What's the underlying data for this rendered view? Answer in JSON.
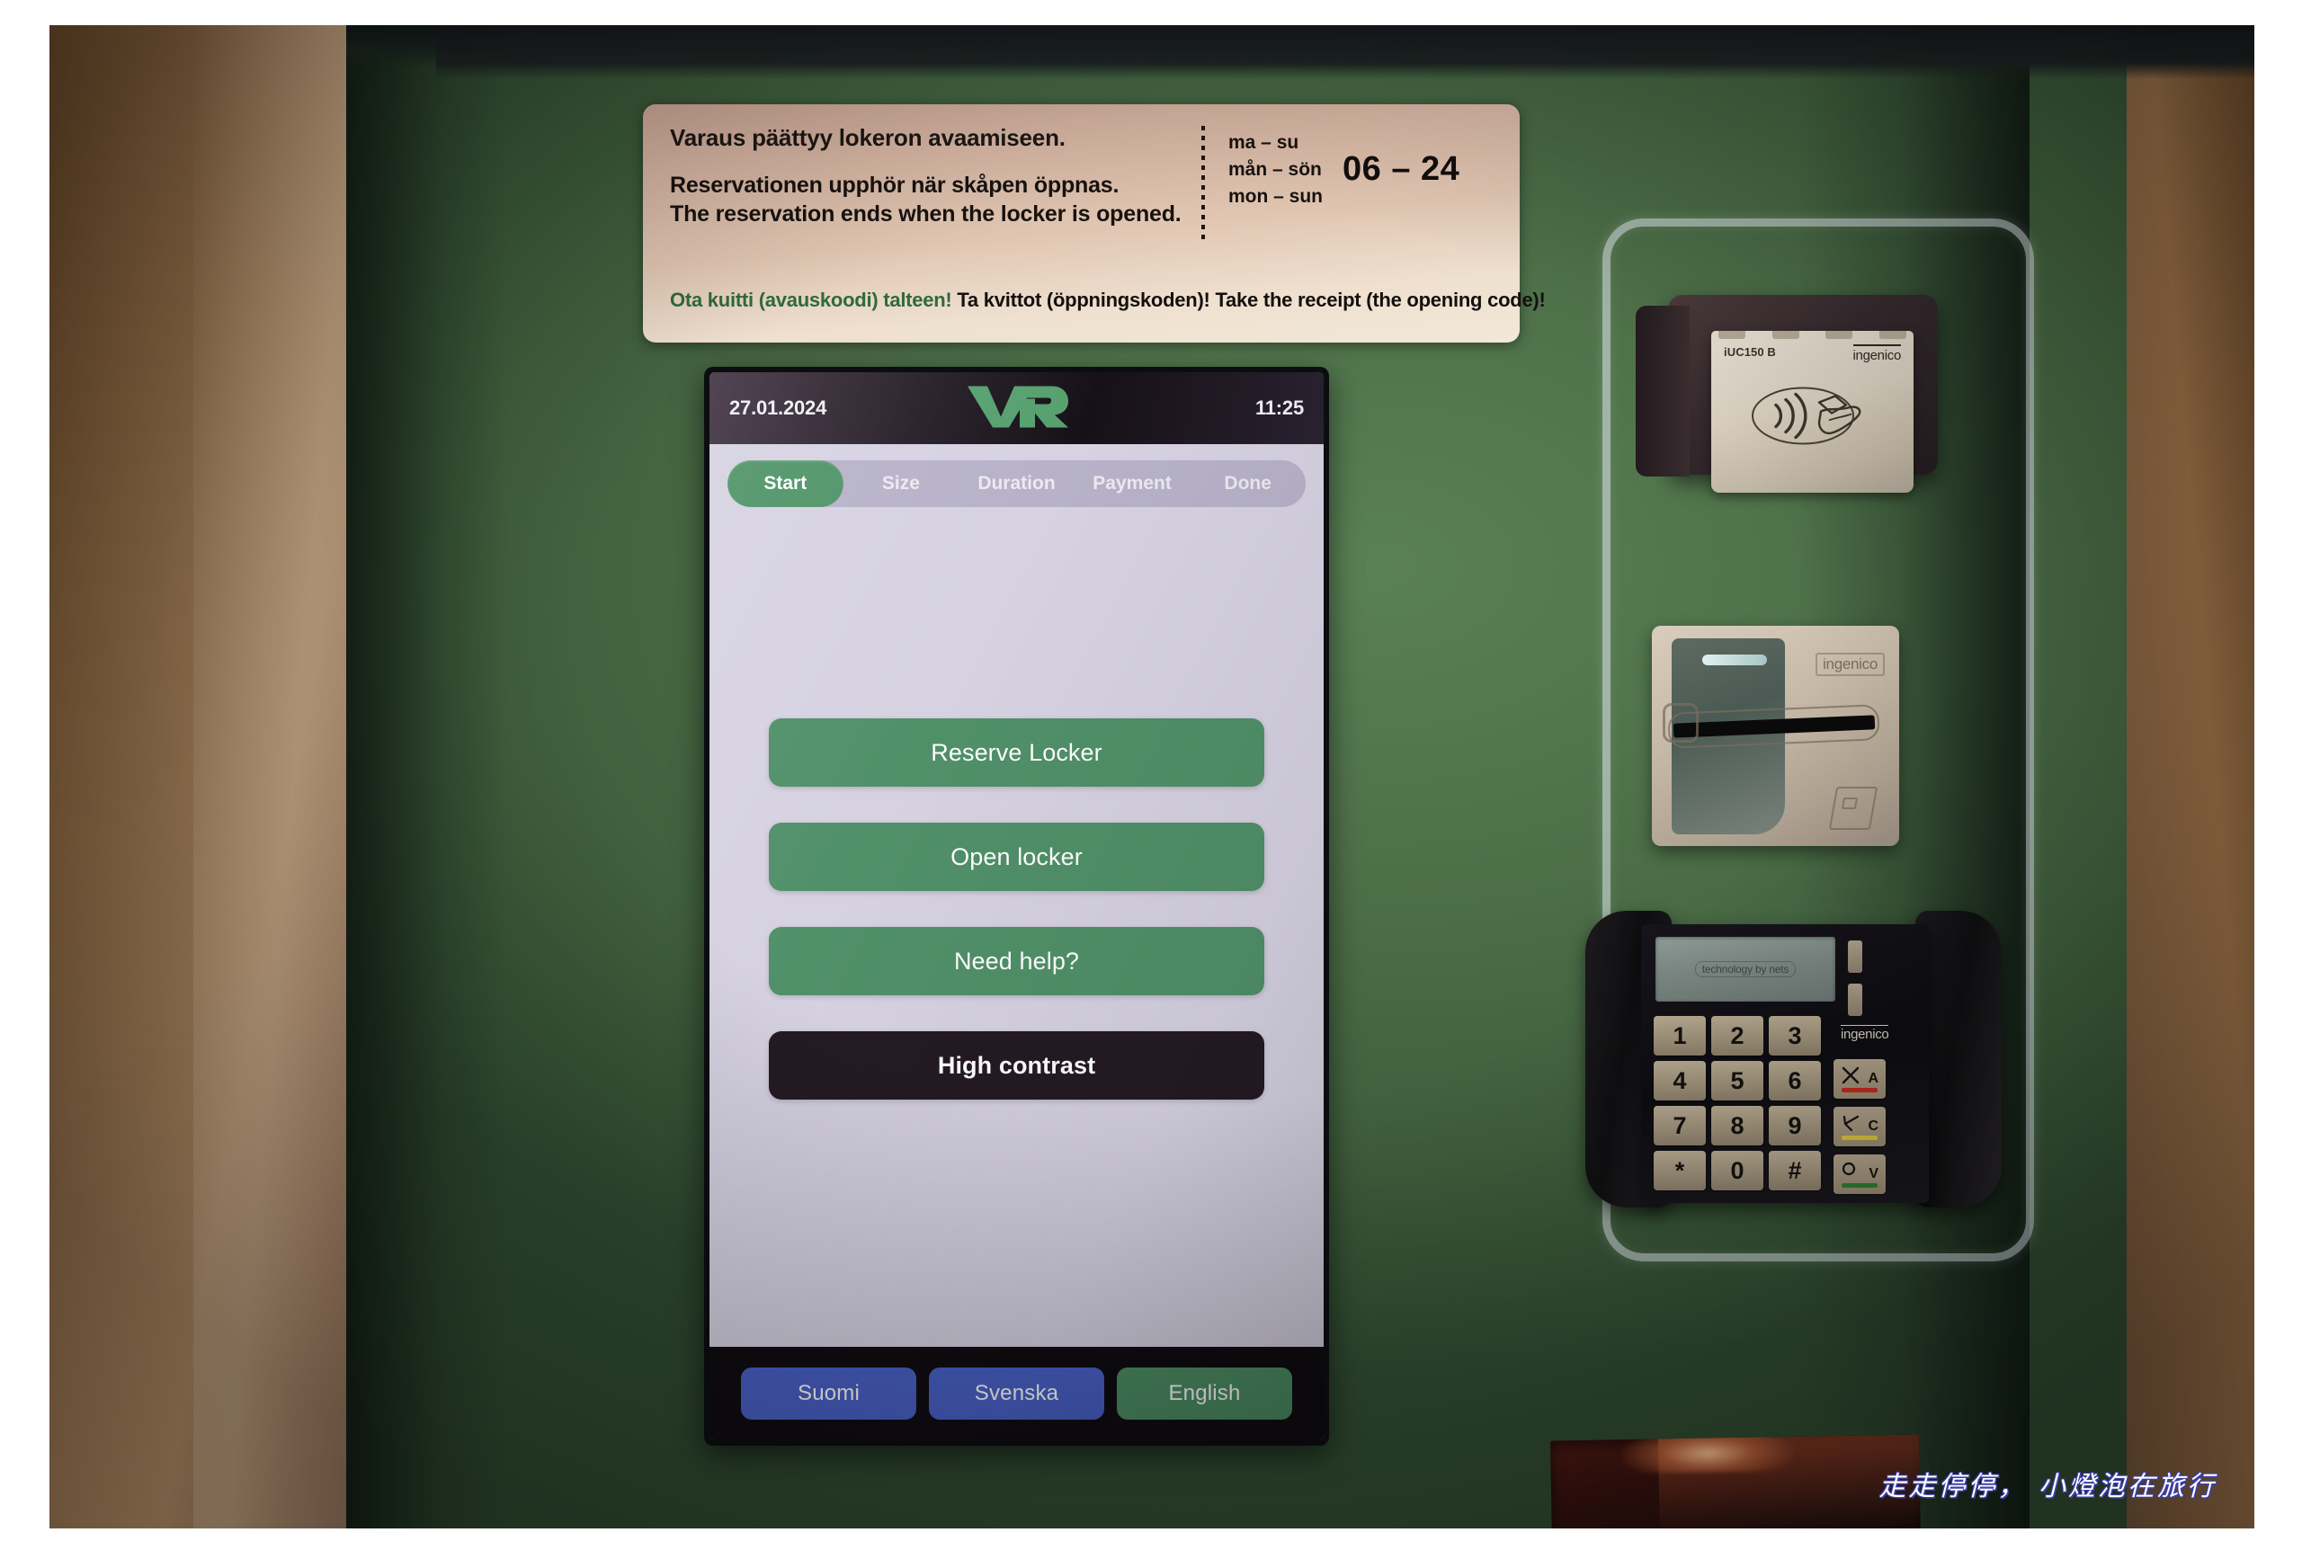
{
  "sign": {
    "line_fi": "Varaus päättyy lokeron avaamiseen.",
    "line_sv": "Reservationen upphör när skåpen öppnas.",
    "line_en": "The reservation ends when the locker is opened.",
    "days_fi": "ma – su",
    "days_sv": "mån – sön",
    "days_en": "mon – sun",
    "hours": "06 – 24",
    "receipt_fi": "Ota kuitti (avauskoodi) talteen!",
    "receipt_rest": "Ta kvittot (öppningskoden)! Take the receipt (the opening code)!"
  },
  "screen": {
    "header": {
      "date": "27.01.2024",
      "time": "11:25",
      "logo_name": "vr-logo"
    },
    "steps": [
      {
        "label": "Start",
        "active": true
      },
      {
        "label": "Size",
        "active": false
      },
      {
        "label": "Duration",
        "active": false
      },
      {
        "label": "Payment",
        "active": false
      },
      {
        "label": "Done",
        "active": false
      }
    ],
    "actions": [
      {
        "label": "Reserve Locker",
        "style": "green"
      },
      {
        "label": "Open locker",
        "style": "green"
      },
      {
        "label": "Need help?",
        "style": "green"
      },
      {
        "label": "High contrast",
        "style": "dark"
      }
    ],
    "languages": [
      {
        "label": "Suomi",
        "selected": false
      },
      {
        "label": "Svenska",
        "selected": false
      },
      {
        "label": "English",
        "selected": true
      }
    ]
  },
  "contactless_reader": {
    "model": "iUC150 B",
    "brand": "ingenico",
    "symbol_name": "contactless-payment-icon"
  },
  "card_slot": {
    "brand": "ingenico",
    "card_icon_name": "insert-card-icon"
  },
  "pinpad": {
    "display_text": "technology by nets",
    "brand": "ingenico",
    "keys": [
      "1",
      "2",
      "3",
      "4",
      "5",
      "6",
      "7",
      "8",
      "9",
      "*",
      "0",
      "#"
    ],
    "function_keys": [
      {
        "letter": "A",
        "color": "#c02a1e",
        "name": "cancel-key"
      },
      {
        "letter": "C",
        "color": "#d8c23a",
        "name": "correct-key"
      },
      {
        "letter": "V",
        "color": "#2e7d32",
        "name": "enter-key"
      }
    ]
  },
  "colors": {
    "kiosk_green": "#4e7049",
    "vr_green": "#56a06e",
    "button_green": "#509069",
    "screen_bg": "#d6d2e2",
    "lang_blue": "#4a61c8",
    "sign_bg": "#e0c6b2",
    "receipt_text_green": "#2f6a3c"
  },
  "watermark": {
    "text": "走走停停， 小燈泡在旅行"
  }
}
